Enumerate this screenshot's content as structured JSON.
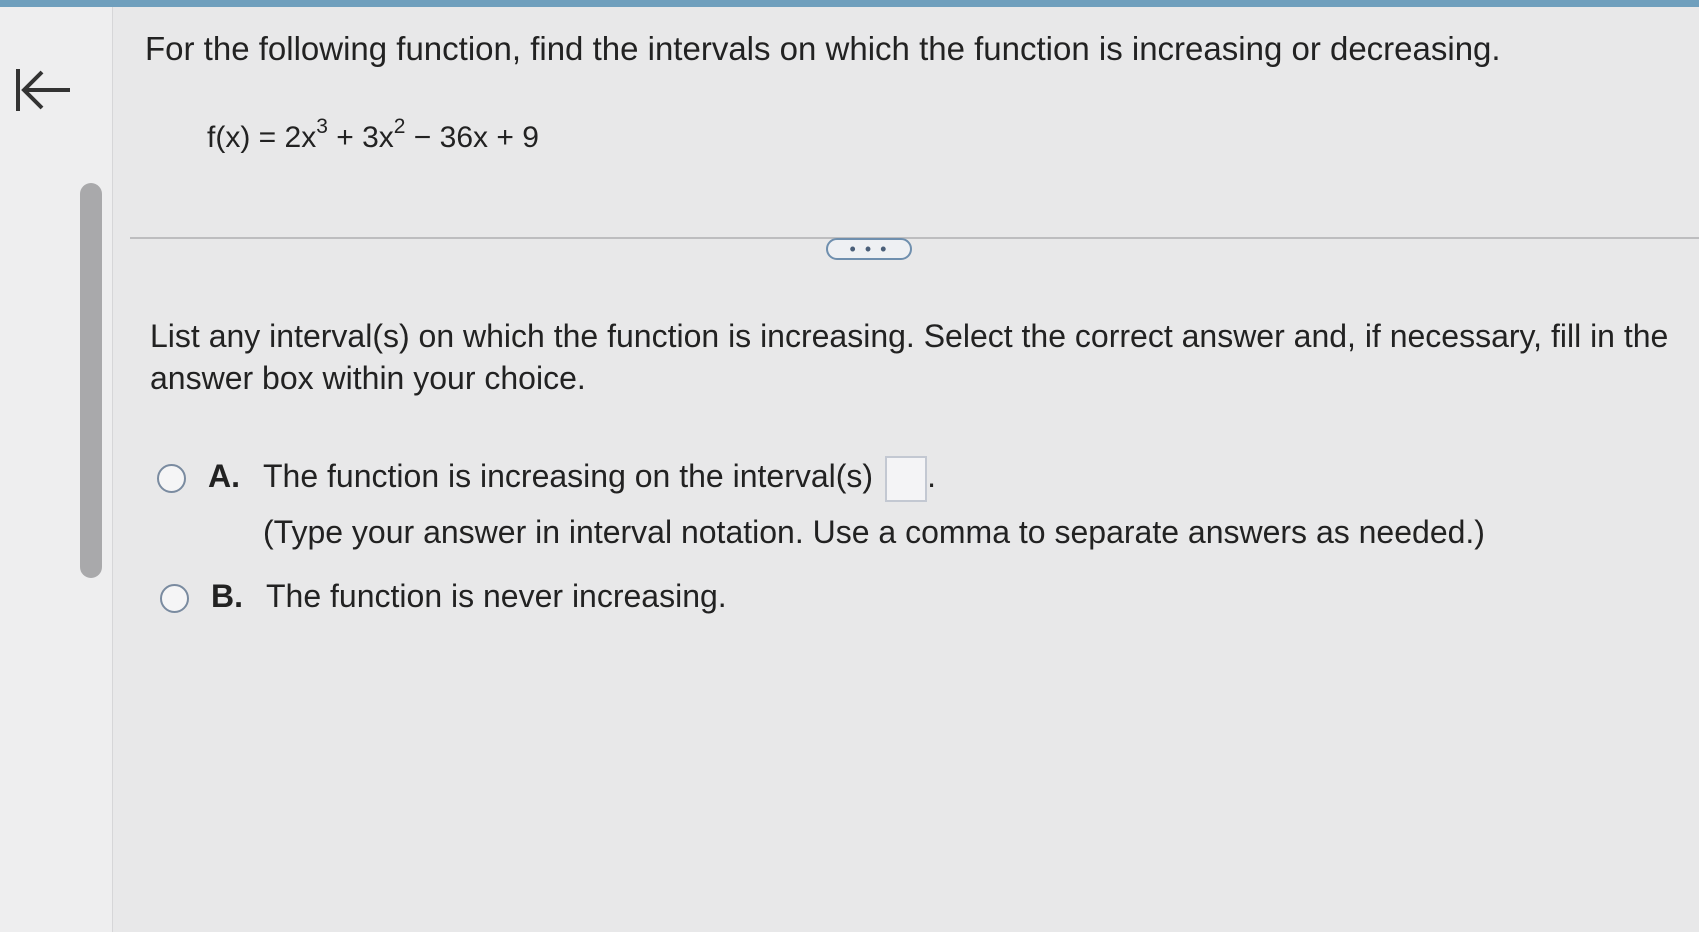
{
  "question": {
    "text": "For the following function, find the intervals on which the function is increasing or decreasing.",
    "formula": {
      "lhs": "f(x) = 2x",
      "exp1": "3",
      "mid": " + 3x",
      "exp2": "2",
      "rhs": " − 36x + 9"
    }
  },
  "more_button": {
    "label": "• • •"
  },
  "instruction": "List any interval(s) on which the function is increasing. Select the correct answer and, if necessary, fill in the answer box within your choice.",
  "options": {
    "a": {
      "letter": "A.",
      "text": "The function is increasing on the interval(s)",
      "answer_value": "",
      "hint": "(Type your answer in interval notation. Use a comma to separate answers as needed.)"
    },
    "b": {
      "letter": "B.",
      "text": "The function is never increasing."
    }
  },
  "icons": {
    "back": "back-to-start-icon"
  },
  "colors": {
    "accent": "#6f9fbd",
    "radio_border": "#7a8ba0",
    "pill_border": "#6f8fae"
  }
}
